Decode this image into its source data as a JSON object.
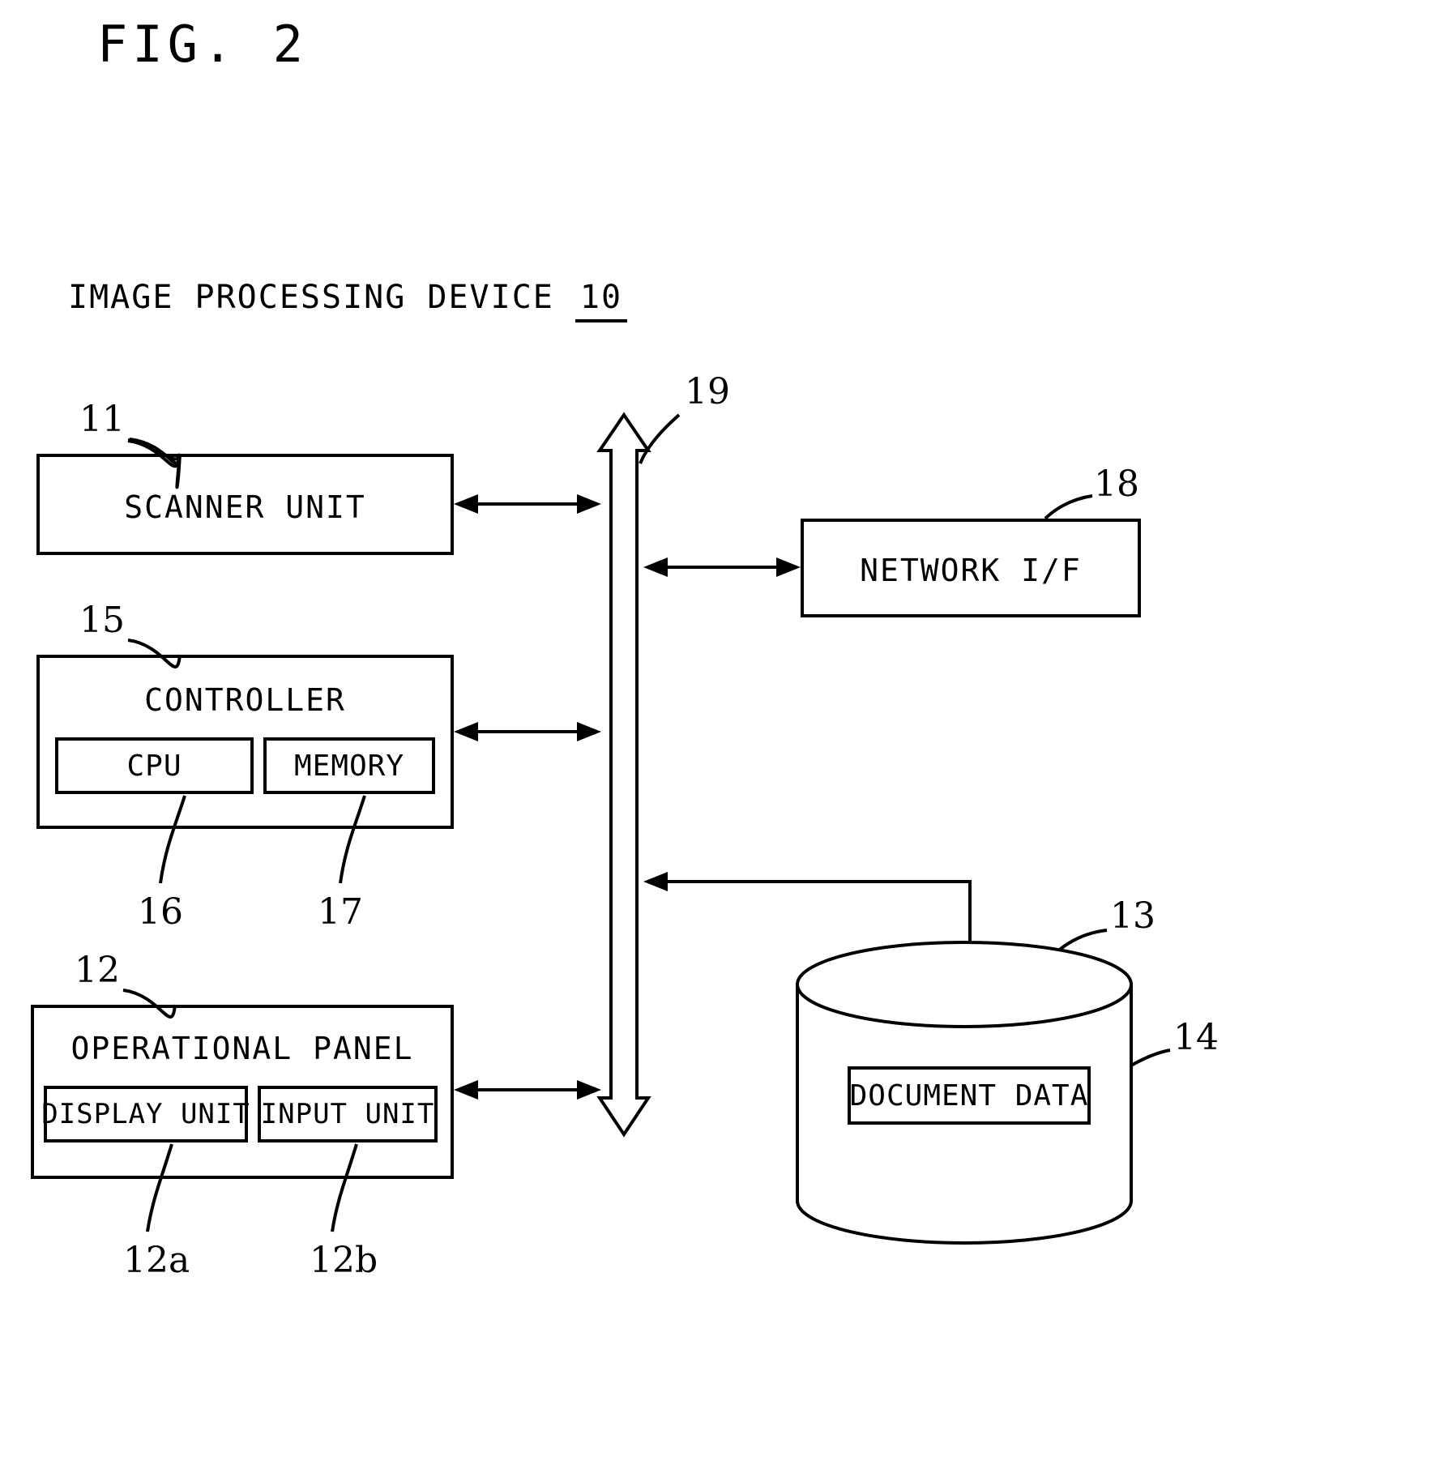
{
  "figure": {
    "title": "FIG. 2",
    "device_title": "IMAGE PROCESSING DEVICE",
    "device_ref": "10"
  },
  "blocks": {
    "scanner": {
      "label": "SCANNER UNIT",
      "ref": "11"
    },
    "controller": {
      "label": "CONTROLLER",
      "ref": "15"
    },
    "cpu": {
      "label": "CPU",
      "ref": "16"
    },
    "memory": {
      "label": "MEMORY",
      "ref": "17"
    },
    "panel": {
      "label": "OPERATIONAL PANEL",
      "ref": "12"
    },
    "display_unit": {
      "label": "DISPLAY UNIT",
      "ref": "12a"
    },
    "input_unit": {
      "label": "INPUT UNIT",
      "ref": "12b"
    },
    "network_if": {
      "label": "NETWORK I/F",
      "ref": "18"
    },
    "bus": {
      "ref": "19"
    },
    "storage": {
      "ref": "13"
    },
    "document_data": {
      "label": "DOCUMENT DATA",
      "ref": "14"
    }
  },
  "style": {
    "line_color": "#000000",
    "background": "#ffffff"
  }
}
